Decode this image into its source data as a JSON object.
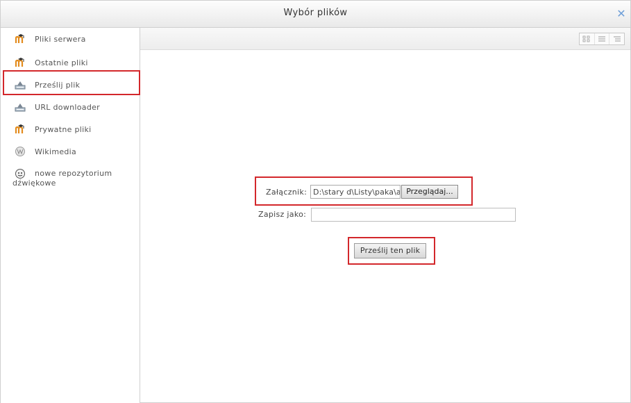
{
  "dialog": {
    "title": "Wybór plików",
    "close_icon": "close-icon"
  },
  "sidebar": {
    "items": [
      {
        "label": "Pliki serwera",
        "icon": "moodle-icon"
      },
      {
        "label": "Ostatnie pliki",
        "icon": "moodle-icon"
      },
      {
        "label": "Prześlij plik",
        "icon": "upload-icon"
      },
      {
        "label": "URL downloader",
        "icon": "upload-icon"
      },
      {
        "label": "Prywatne pliki",
        "icon": "moodle-icon"
      },
      {
        "label": "Wikimedia",
        "icon": "wikimedia-icon"
      },
      {
        "label": "nowe repozytorium",
        "label2": "dźwiękowe",
        "icon": "sound-repo-icon"
      }
    ]
  },
  "toolbar": {
    "views": [
      "icons-view-icon",
      "list-view-icon",
      "details-view-icon"
    ]
  },
  "form": {
    "attachment_label": "Załącznik:",
    "attachment_value": "D:\\stary d\\Listy\\paka\\a",
    "browse_label": "Przeglądaj...",
    "save_as_label": "Zapisz jako:",
    "save_as_value": "",
    "upload_label": "Prześlij ten plik"
  },
  "colors": {
    "highlight": "#d3272b",
    "close": "#6f9fd8",
    "moodle_orange": "#e38b1c"
  }
}
